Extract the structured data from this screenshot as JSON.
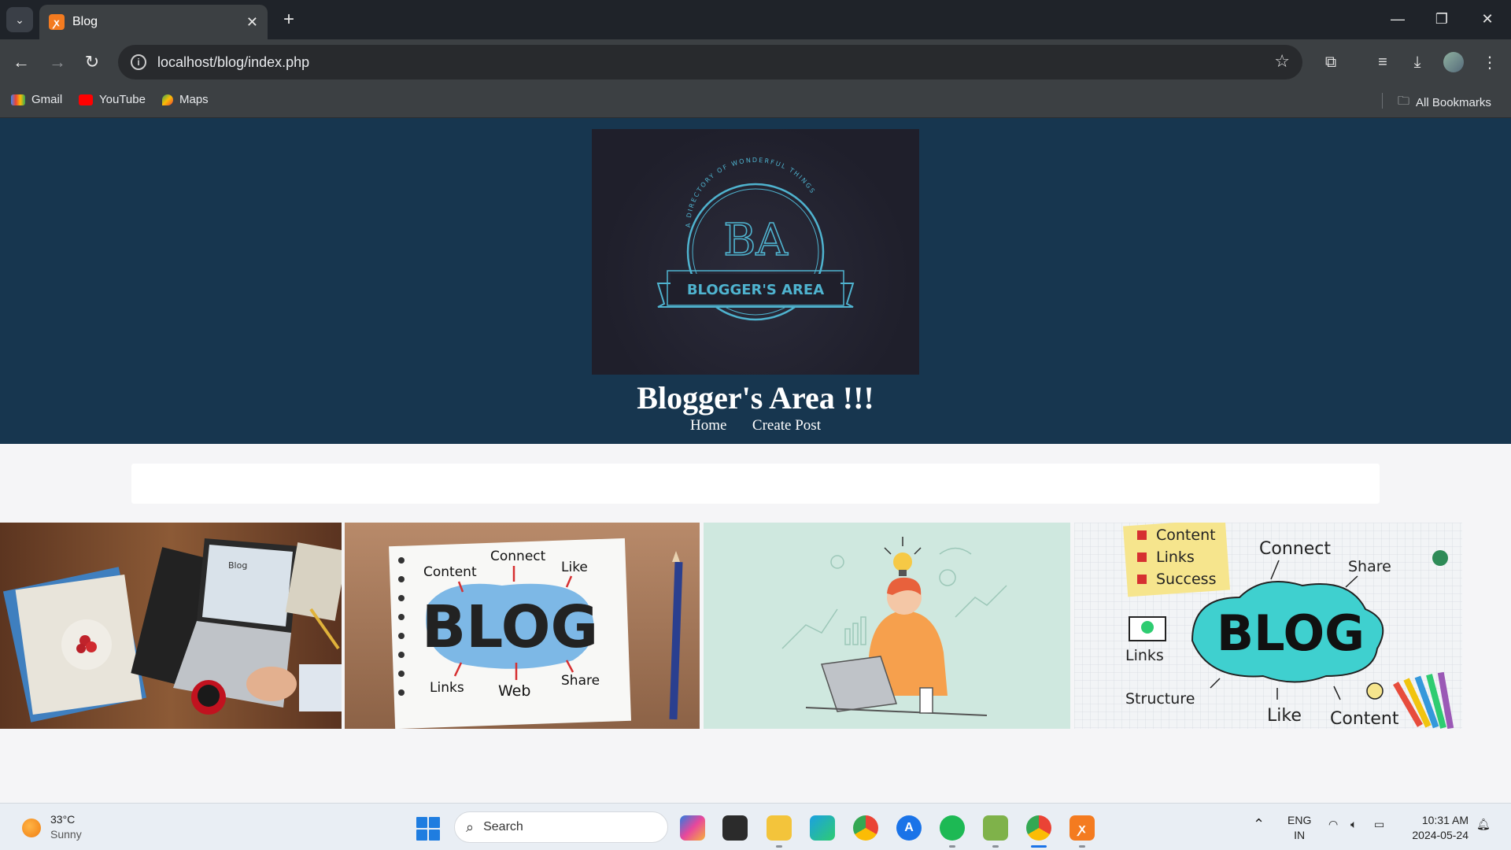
{
  "browser": {
    "tab_title": "Blog",
    "url": "localhost/blog/index.php",
    "bookmarks": [
      {
        "label": "Gmail"
      },
      {
        "label": "YouTube"
      },
      {
        "label": "Maps"
      }
    ],
    "all_bookmarks_label": "All Bookmarks"
  },
  "site": {
    "logo_text": "BLOGGER'S AREA",
    "logo_monogram": "BA",
    "logo_ring_text": "A DIRECTORY OF WONDERFUL THINGS",
    "title": "Blogger's Area !!!",
    "nav": [
      {
        "label": "Home"
      },
      {
        "label": "Create Post"
      }
    ]
  },
  "cards": [
    {
      "image": "laptop-desk-photo",
      "screen_text": "Blog"
    },
    {
      "image": "blog-notepad-photo",
      "big_text": "BLOG",
      "words": [
        "Content",
        "Connect",
        "Like",
        "Links",
        "Web",
        "Share"
      ]
    },
    {
      "image": "thinking-man-illustration"
    },
    {
      "image": "blog-cloud-photo",
      "big_text": "BLOG",
      "words": [
        "Content",
        "Links",
        "Success",
        "Connect",
        "Share",
        "Links",
        "Structure",
        "Like",
        "Content"
      ]
    }
  ],
  "taskbar": {
    "weather_temp": "33°C",
    "weather_condition": "Sunny",
    "search_placeholder": "Search",
    "language": "ENG",
    "region": "IN",
    "time": "10:31 AM",
    "date": "2024-05-24"
  },
  "colors": {
    "header_bg": "#17364f",
    "logo_accent": "#4fb3cf",
    "page_bg": "#f5f5f7"
  }
}
